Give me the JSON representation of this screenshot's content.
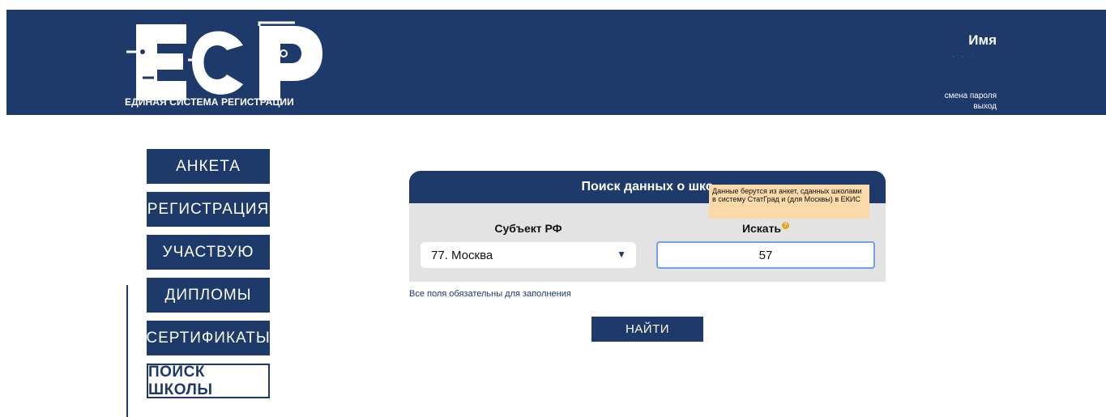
{
  "header": {
    "brand_letters": "ЕСР",
    "brand_tagline": "ЕДИНАЯ СИСТЕМА РЕГИСТРАЦИИ",
    "user_name": "Имя",
    "change_password": "смена пароля",
    "logout": "выход",
    "background_color": "#1d3a6b"
  },
  "sidebar": {
    "items": [
      {
        "label": "АНКЕТА"
      },
      {
        "label": "РЕГИСТРАЦИЯ"
      },
      {
        "label": "УЧАСТВУЮ"
      },
      {
        "label": "ДИПЛОМЫ"
      },
      {
        "label": "СЕРТИФИКАТЫ"
      },
      {
        "label": "ПОИСК ШКОЛЫ",
        "active": true
      }
    ]
  },
  "search_panel": {
    "title": "Поиск данных о шко",
    "subject_label": "Субъект РФ",
    "subject_value": "77. Москва",
    "search_label": "Искать",
    "search_value": "57",
    "tooltip": "Данные берутся из анкет, сданных школами в систему СтатГрад и (для Москвы) в ЕКИС",
    "required_note": "Все поля обязательны для заполнения",
    "find_button": "НАЙТИ"
  },
  "colors": {
    "primary": "#1d3a6b",
    "panel_bg": "#e3e3e3",
    "tooltip_bg": "#fcd9a8",
    "input_focus": "#6fa3e8",
    "help_icon": "#e8a317"
  }
}
